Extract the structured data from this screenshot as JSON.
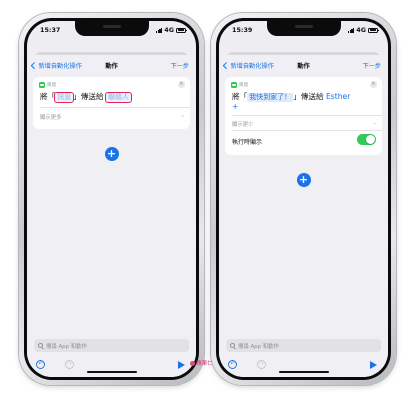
{
  "left_phone": {
    "status": {
      "time": "15:37",
      "network": "4G"
    },
    "nav": {
      "back_label": "新增自動化操作",
      "title": "動作",
      "next_label": "下一步"
    },
    "card": {
      "app_label": "訊息",
      "prefix": "將「",
      "message_token": "訊息",
      "middle": "」傳送給",
      "recipient_token": "聯絡人",
      "show_more": "顯示更多"
    },
    "search_placeholder": "搜尋 App 和動作"
  },
  "right_phone": {
    "status": {
      "time": "15:39",
      "network": "4G"
    },
    "nav": {
      "back_label": "新增自動化操作",
      "title": "動作",
      "next_label": "下一步"
    },
    "card": {
      "app_label": "訊息",
      "prefix": "將「",
      "message_token": "我快到家了！",
      "middle": "」傳送給",
      "recipient": "Esther",
      "add_symbol": "+",
      "show_less": "顯示更少",
      "show_when_run": "執行時顯示",
      "show_when_run_on": true
    },
    "search_placeholder": "搜尋 App 和動作"
  },
  "watermark": "蘋果仁",
  "colors": {
    "accent": "#1a73e8",
    "toggle_on": "#34c759",
    "highlight_outline": "#e0245e"
  }
}
